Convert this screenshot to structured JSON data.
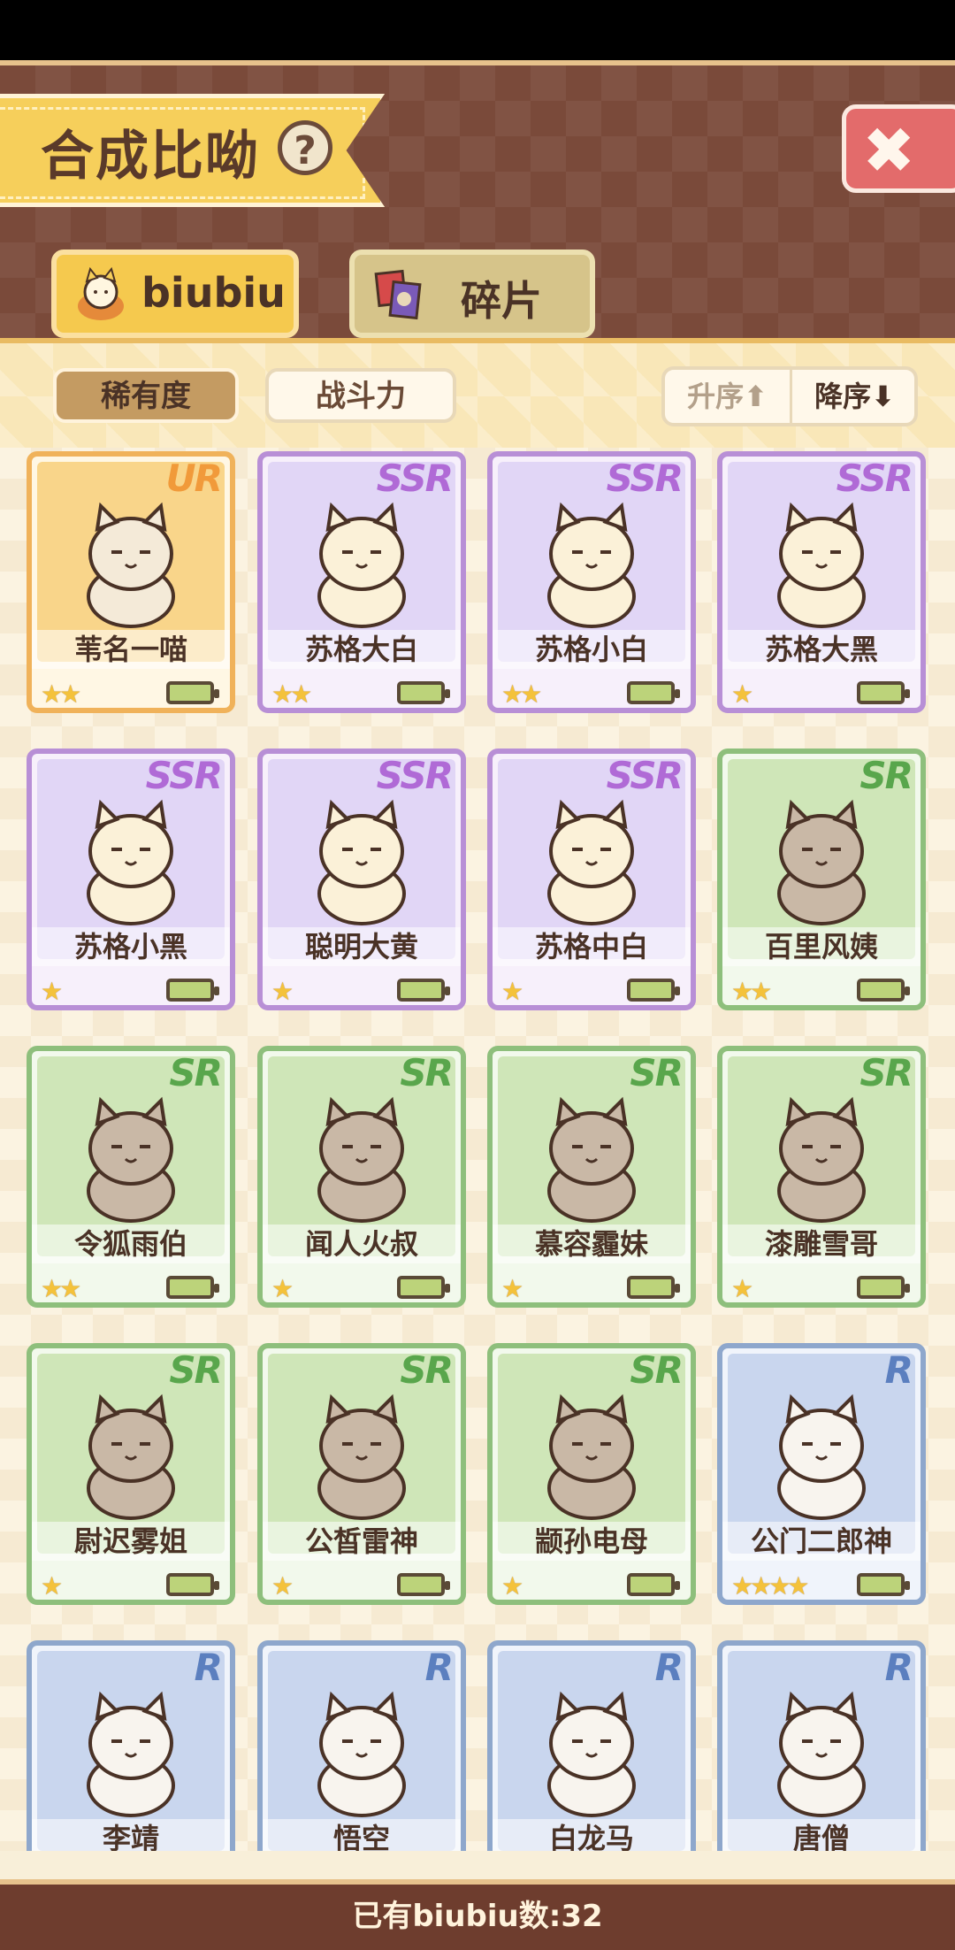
{
  "title": "合成比呦",
  "help_glyph": "?",
  "close_glyph": "✖",
  "tabs": [
    {
      "label": "biubiu",
      "active": true
    },
    {
      "label": "碎片",
      "active": false
    }
  ],
  "filters": {
    "rarity": "稀有度",
    "power": "战斗力",
    "active": "稀有度"
  },
  "sort": {
    "asc": "升序⬆",
    "desc": "降序⬇",
    "active": "desc"
  },
  "cards": [
    {
      "name": "苇名一喵",
      "rarity": "UR",
      "stars": "★★"
    },
    {
      "name": "苏格大白",
      "rarity": "SSR",
      "stars": "★★"
    },
    {
      "name": "苏格小白",
      "rarity": "SSR",
      "stars": "★★"
    },
    {
      "name": "苏格大黑",
      "rarity": "SSR",
      "stars": "★"
    },
    {
      "name": "苏格小黑",
      "rarity": "SSR",
      "stars": "★"
    },
    {
      "name": "聪明大黄",
      "rarity": "SSR",
      "stars": "★"
    },
    {
      "name": "苏格中白",
      "rarity": "SSR",
      "stars": "★"
    },
    {
      "name": "百里风姨",
      "rarity": "SR",
      "stars": "★★"
    },
    {
      "name": "令狐雨伯",
      "rarity": "SR",
      "stars": "★★"
    },
    {
      "name": "闻人火叔",
      "rarity": "SR",
      "stars": "★"
    },
    {
      "name": "慕容霾妹",
      "rarity": "SR",
      "stars": "★"
    },
    {
      "name": "漆雕雪哥",
      "rarity": "SR",
      "stars": "★"
    },
    {
      "name": "尉迟雾姐",
      "rarity": "SR",
      "stars": "★"
    },
    {
      "name": "公皙雷神",
      "rarity": "SR",
      "stars": "★"
    },
    {
      "name": "颛孙电母",
      "rarity": "SR",
      "stars": "★"
    },
    {
      "name": "公门二郎神",
      "rarity": "R",
      "stars": "★★★★"
    },
    {
      "name": "李靖",
      "rarity": "R",
      "stars": ""
    },
    {
      "name": "悟空",
      "rarity": "R",
      "stars": ""
    },
    {
      "name": "白龙马",
      "rarity": "R",
      "stars": ""
    },
    {
      "name": "唐僧",
      "rarity": "R",
      "stars": ""
    }
  ],
  "footer": "已有biubiu数:32",
  "colors": {
    "header_bg": "#7a4a3a",
    "banner": "#f6cf5b",
    "ur": "#f0b25a",
    "ssr": "#b88fd6",
    "sr": "#8ebf7c",
    "r": "#8ea7cc"
  }
}
